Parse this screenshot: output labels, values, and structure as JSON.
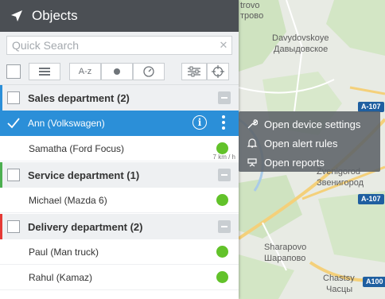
{
  "panel": {
    "title": "Objects",
    "search_placeholder": "Quick Search",
    "toolbar": {
      "sort_label": "A-z"
    },
    "groups": [
      {
        "name": "Sales department (2)",
        "color": "#2b8fd8"
      },
      {
        "name": "Service department (1)",
        "color": "#4caf50"
      },
      {
        "name": "Delivery department (2)",
        "color": "#e53935"
      }
    ],
    "units": [
      {
        "name": "Ann (Volkswagen)",
        "selected": true
      },
      {
        "name": "Samatha (Ford Focus)",
        "speed": "7 km / h",
        "status_color": "#62c22a"
      },
      {
        "name": "Michael (Mazda 6)",
        "status_color": "#62c22a"
      },
      {
        "name": "Paul (Man truck)",
        "status_color": "#62c22a"
      },
      {
        "name": "Rahul (Kamaz)",
        "status_color": "#62c22a"
      }
    ]
  },
  "context_menu": {
    "items": [
      {
        "label": "Open device settings",
        "icon": "wrench-icon"
      },
      {
        "label": "Open alert rules",
        "icon": "bell-icon"
      },
      {
        "label": "Open reports",
        "icon": "report-icon"
      }
    ]
  },
  "map": {
    "labels": {
      "trovo": "trovo",
      "trovo_ru": "тровo",
      "davydovskoye": "Davydovskoye",
      "davydovskoye_ru": "Давыдовское",
      "zvenigorod": "Zvenigorod",
      "zvenigorod_ru": "Звенигород",
      "sharapovo": "Sharapovo",
      "sharapovo_ru": "Шарапово",
      "chastsy": "Chastsy",
      "chastsy_ru": "Часцы"
    },
    "road_badges": {
      "a107_top": "A-107",
      "a107_mid": "A-107",
      "a100": "A100"
    }
  }
}
